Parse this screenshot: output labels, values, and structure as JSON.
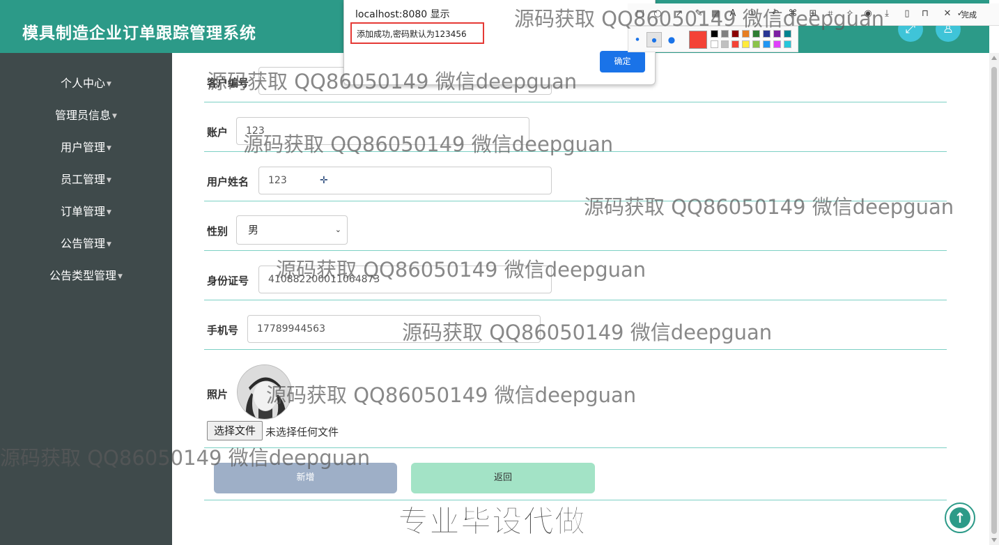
{
  "header": {
    "title": "模具制造企业订单跟踪管理系统"
  },
  "sidebar": {
    "items": [
      {
        "label": "个人中心"
      },
      {
        "label": "管理员信息"
      },
      {
        "label": "用户管理"
      },
      {
        "label": "员工管理"
      },
      {
        "label": "订单管理"
      },
      {
        "label": "公告管理"
      },
      {
        "label": "公告类型管理"
      }
    ]
  },
  "form": {
    "customer_no": {
      "label": "客户编号",
      "value": ""
    },
    "account": {
      "label": "账户",
      "value": "123"
    },
    "user_name": {
      "label": "用户姓名",
      "value": "123"
    },
    "gender": {
      "label": "性别",
      "value": "男"
    },
    "id_card": {
      "label": "身份证号",
      "value": "410882200011064873"
    },
    "phone": {
      "label": "手机号",
      "value": "17789944563"
    },
    "photo": {
      "label": "照片",
      "file_button": "选择文件",
      "file_status": "未选择任何文件"
    },
    "add_button": "新增",
    "back_button": "返回"
  },
  "dialog": {
    "origin": "localhost:8080 显示",
    "message": "添加成功,密码默认为123456",
    "ok": "确定"
  },
  "toolbar": {
    "done": "完成"
  },
  "watermarks": [
    "源码获取 QQ86050149 微信deepguan",
    "源码获取 QQ86050149 微信deepguan",
    "源码获取 QQ86050149 微信deepguan",
    "源码获取 QQ86050149 微信deepguan",
    "源码获取 QQ86050149 微信deepguan",
    "源码获取 QQ86050149 微信deepguan",
    "源码获取 QQ86050149 微信deepguan",
    "源码获取 QQ86050149 微信deepguan"
  ],
  "banner": "专业毕设代做",
  "colors": {
    "header": "#2c9a88",
    "sidebar": "#3f4a4b",
    "accent_blue": "#1a73e8",
    "highlight_red": "#e53935"
  }
}
